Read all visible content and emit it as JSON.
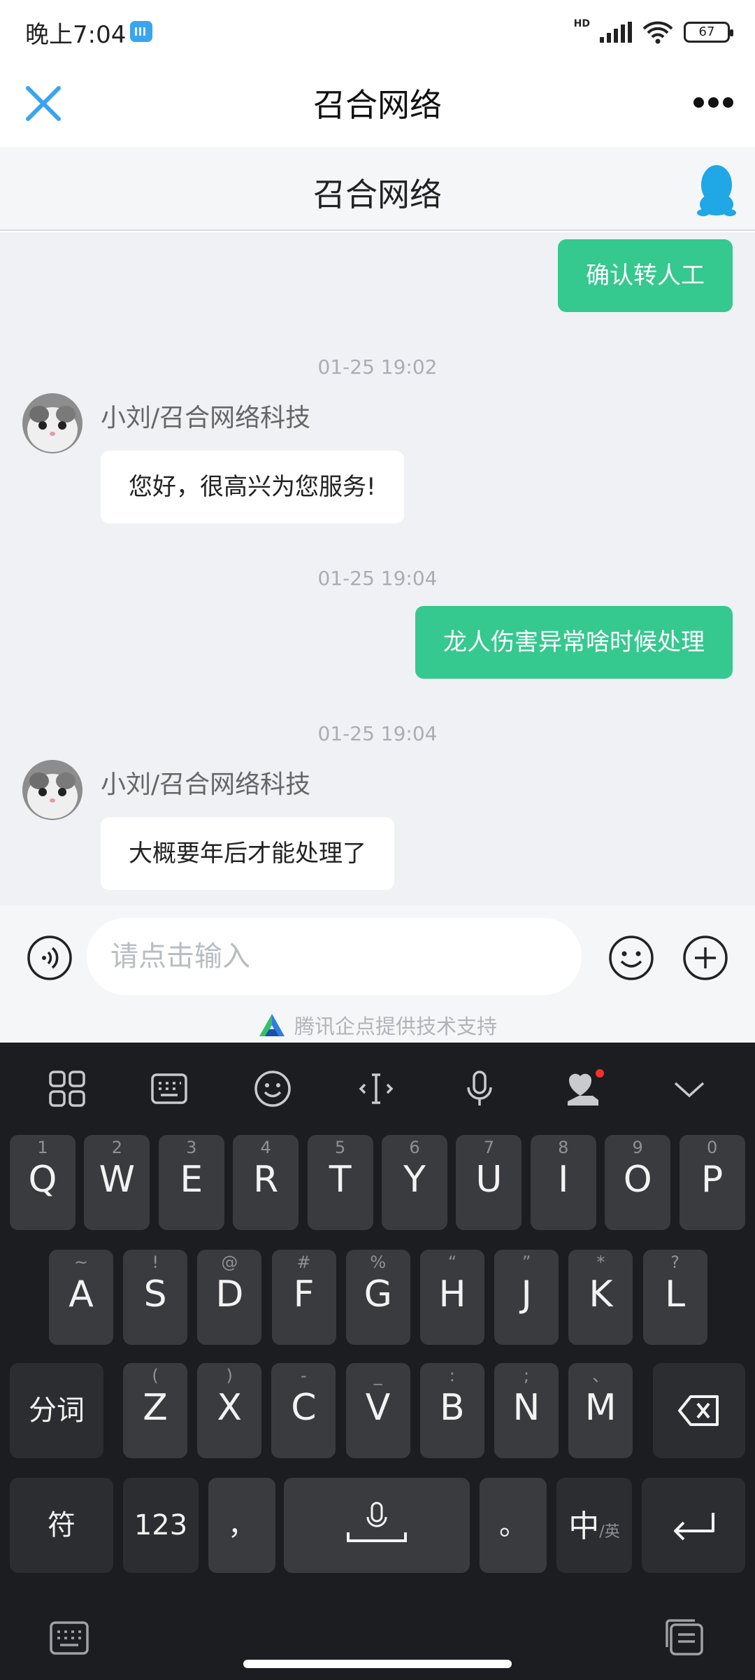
{
  "status_bar": {
    "time": "晚上7:04",
    "signal_label": "HD",
    "battery": "67"
  },
  "nav": {
    "title": "召合网络",
    "close_icon": "close-icon",
    "more_icon": "more-icon"
  },
  "chat_header": {
    "title": "召合网络",
    "icon": "qq-penguin-icon"
  },
  "messages": [
    {
      "type": "outgoing",
      "text": "确认转人工"
    },
    {
      "type": "timestamp",
      "text": "01-25 19:02"
    },
    {
      "type": "incoming",
      "sender": "小刘/召合网络科技",
      "text": "您好，很高兴为您服务!"
    },
    {
      "type": "timestamp",
      "text": "01-25 19:04"
    },
    {
      "type": "outgoing",
      "text": "龙人伤害异常啥时候处理"
    },
    {
      "type": "timestamp",
      "text": "01-25 19:04"
    },
    {
      "type": "incoming",
      "sender": "小刘/召合网络科技",
      "text": "大概要年后才能处理了"
    }
  ],
  "input_bar": {
    "placeholder": "请点击输入",
    "powered_by": "腾讯企点提供技术支持"
  },
  "keyboard": {
    "row1": [
      {
        "main": "Q",
        "sub": "1"
      },
      {
        "main": "W",
        "sub": "2"
      },
      {
        "main": "E",
        "sub": "3"
      },
      {
        "main": "R",
        "sub": "4"
      },
      {
        "main": "T",
        "sub": "5"
      },
      {
        "main": "Y",
        "sub": "6"
      },
      {
        "main": "U",
        "sub": "7"
      },
      {
        "main": "I",
        "sub": "8"
      },
      {
        "main": "O",
        "sub": "9"
      },
      {
        "main": "P",
        "sub": "0"
      }
    ],
    "row2": [
      {
        "main": "A",
        "sub": "~"
      },
      {
        "main": "S",
        "sub": "!"
      },
      {
        "main": "D",
        "sub": "@"
      },
      {
        "main": "F",
        "sub": "#"
      },
      {
        "main": "G",
        "sub": "%"
      },
      {
        "main": "H",
        "sub": "“"
      },
      {
        "main": "J",
        "sub": "”"
      },
      {
        "main": "K",
        "sub": "*"
      },
      {
        "main": "L",
        "sub": "?"
      }
    ],
    "row3": {
      "left": "分词",
      "keys": [
        {
          "main": "Z",
          "sub": "("
        },
        {
          "main": "X",
          "sub": ")"
        },
        {
          "main": "C",
          "sub": "-"
        },
        {
          "main": "V",
          "sub": "_"
        },
        {
          "main": "B",
          "sub": ":"
        },
        {
          "main": "N",
          "sub": ";"
        },
        {
          "main": "M",
          "sub": "、"
        }
      ]
    },
    "row4": {
      "symbols": "符",
      "numbers": "123",
      "comma": "，",
      "period": "。",
      "lang_main": "中",
      "lang_sub": "/英"
    },
    "colors": {
      "background": "#1c1d20",
      "key": "#3a3b3f"
    }
  },
  "colors": {
    "accent": "#35c88f",
    "close": "#3aa4f0"
  }
}
